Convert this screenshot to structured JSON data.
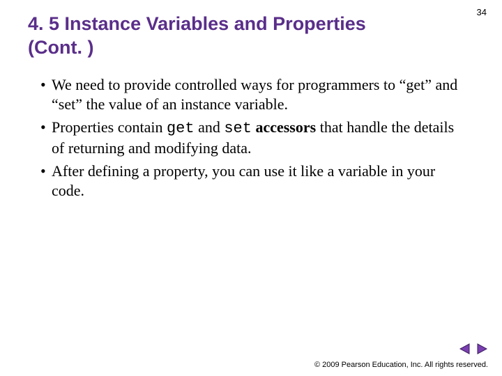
{
  "page_number": "34",
  "title": "4. 5  Instance Variables and Properties (Cont. )",
  "bullets": [
    {
      "pre": "We need to provide controlled ways for programmers to “get” and “set” the value of an instance variable."
    },
    {
      "pre": "Properties contain ",
      "code1": "get",
      "mid": " and ",
      "code2": "set",
      "acc": " accessors",
      "post": " that handle the details of returning and modifying data."
    },
    {
      "pre": "After defining a property, you can use it like a variable in your code."
    }
  ],
  "footer": "© 2009 Pearson Education, Inc.  All rights reserved.",
  "nav": {
    "prev": "previous-slide",
    "next": "next-slide"
  },
  "colors": {
    "title": "#5a2e8a",
    "nav_fill": "#7a3fb0",
    "nav_stroke": "#3e1f63"
  }
}
